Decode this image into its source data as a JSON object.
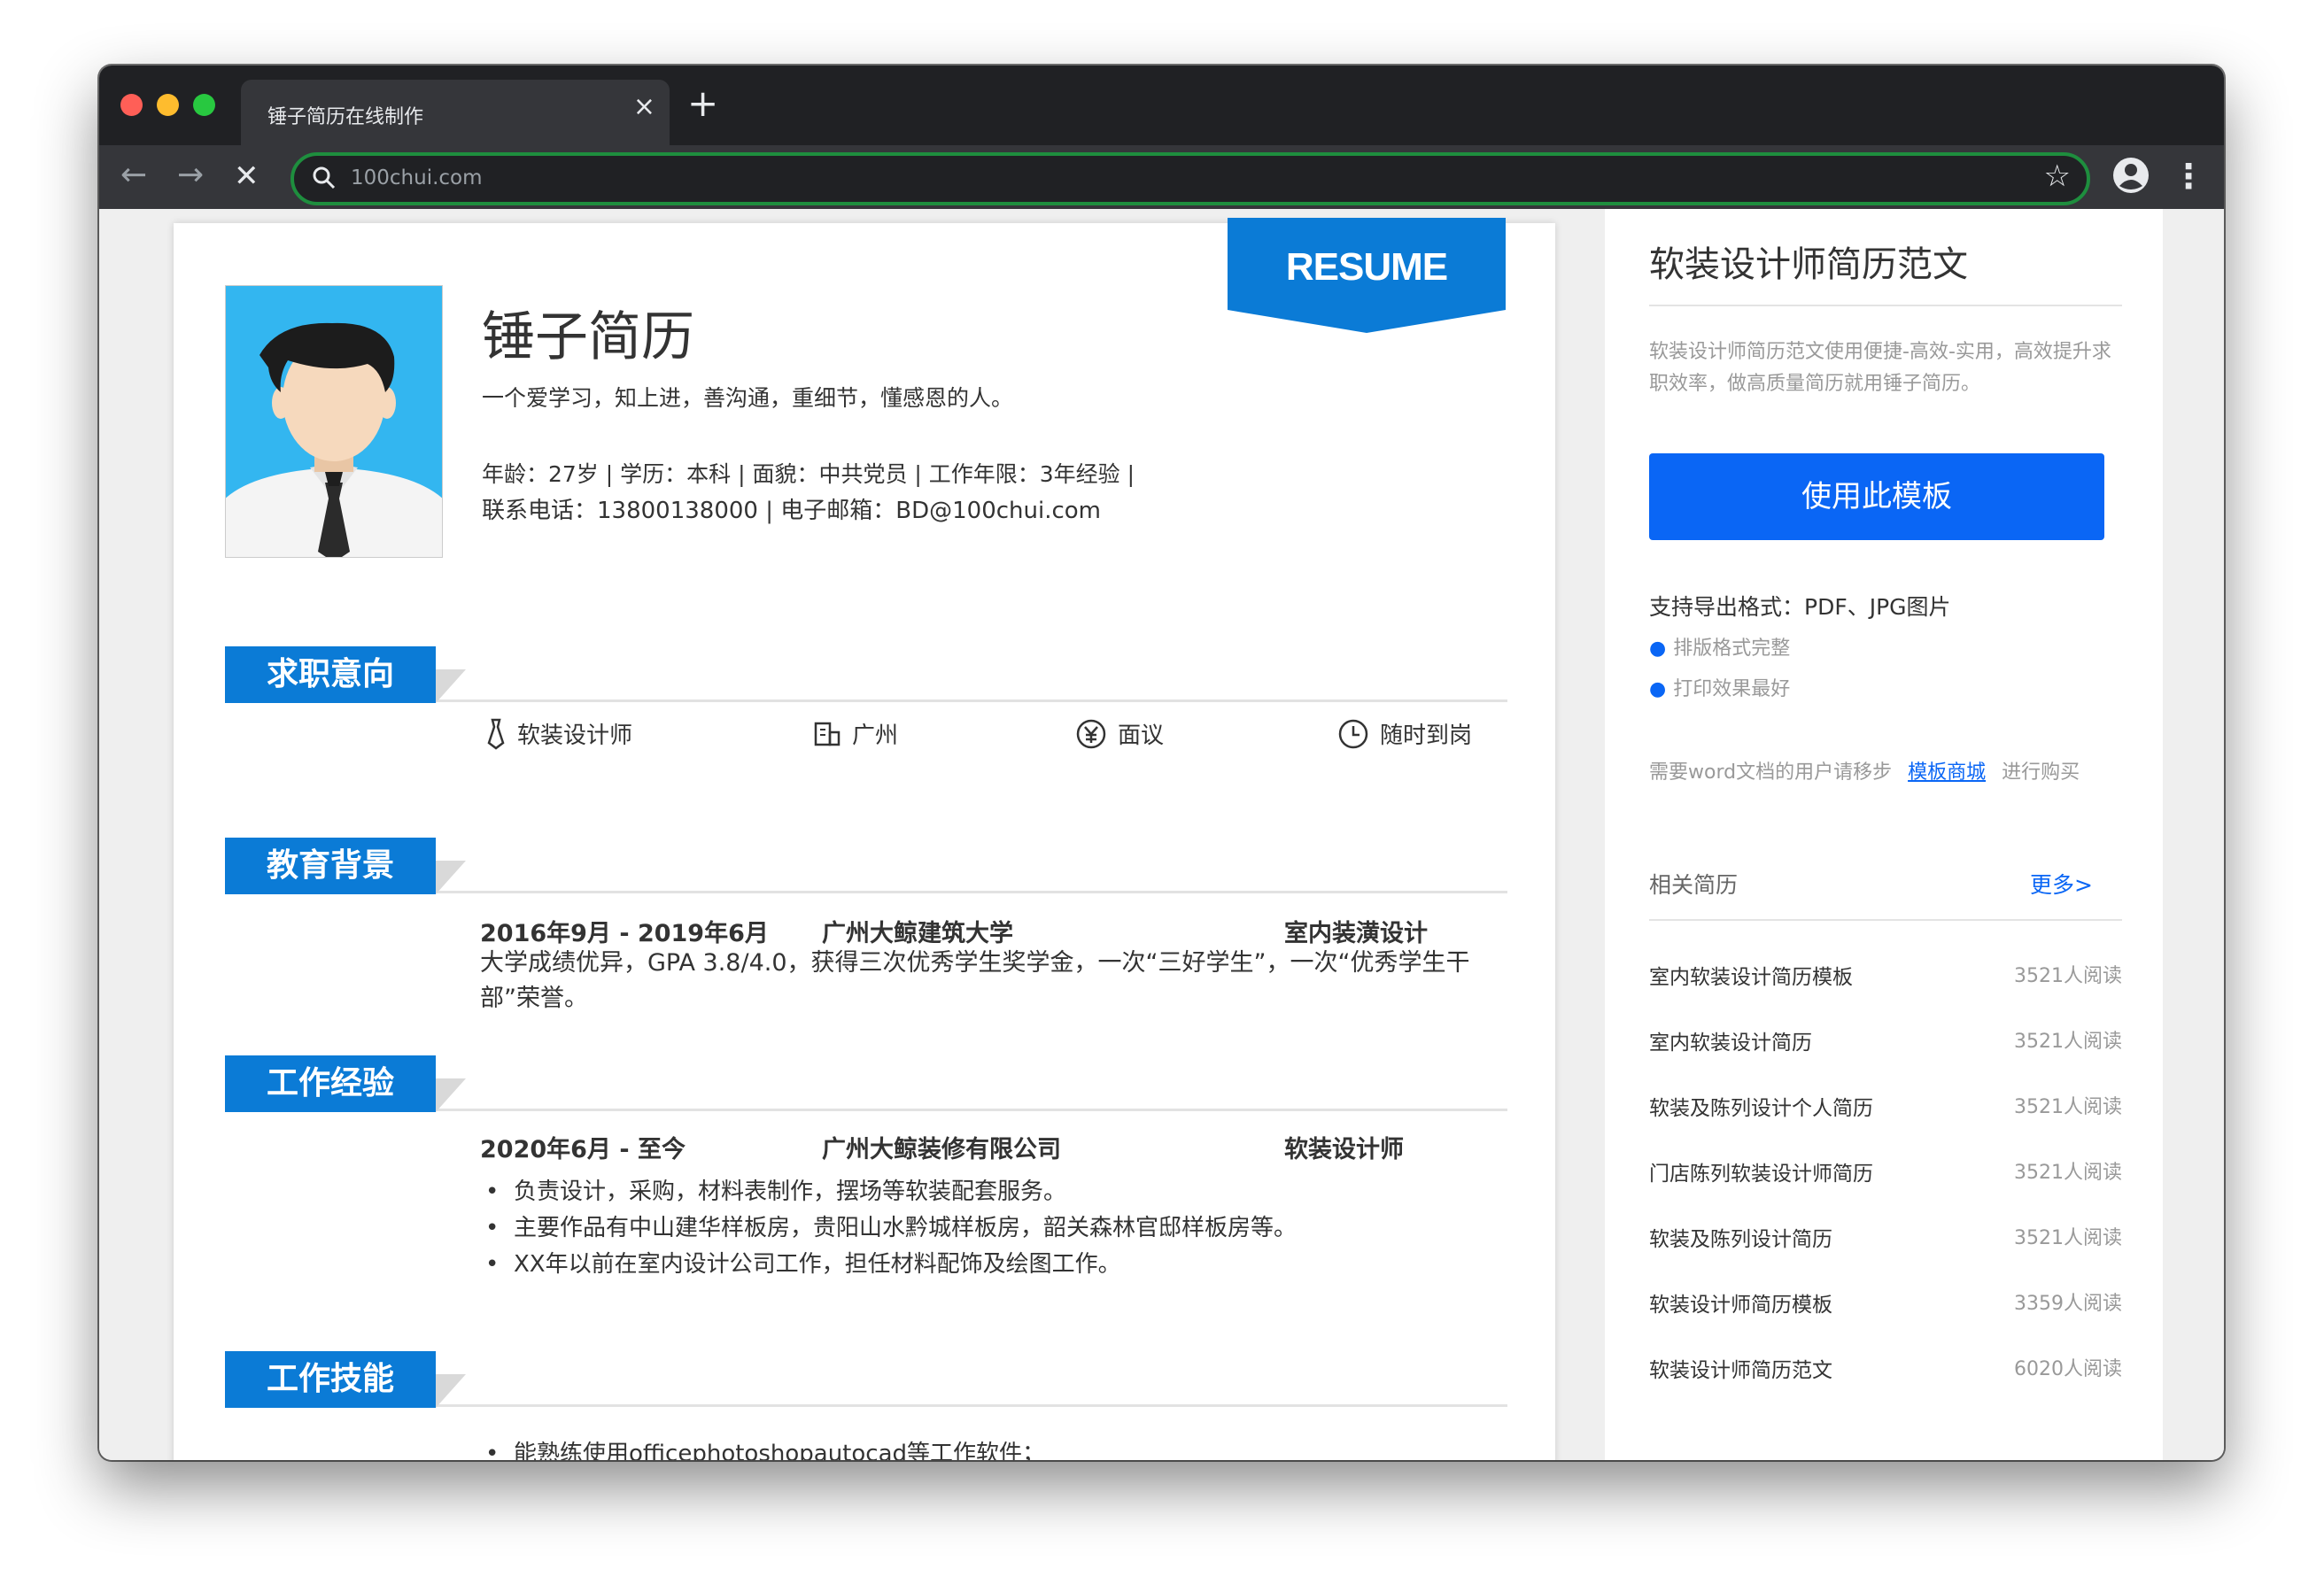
{
  "browser": {
    "tab_title": "锤子简历在线制作",
    "tab_close": "×",
    "new_tab": "+",
    "url": "100chui.com",
    "back": "←",
    "forward": "→",
    "stop": "✕",
    "star": "☆",
    "menu": "⋮"
  },
  "resume": {
    "badge": "RESUME",
    "name": "锤子简历",
    "motto": "一个爱学习，知上进，善沟通，重细节，懂感恩的人。",
    "info_line1": "年龄：27岁 | 学历：本科 | 面貌：中共党员 | 工作年限：3年经验 |",
    "info_line2": "联系电话：13800138000 | 电子邮箱：BD@100chui.com",
    "sections": {
      "intent": "求职意向",
      "education": "教育背景",
      "work": "工作经验",
      "skills": "工作技能"
    },
    "intent": {
      "position": "软装设计师",
      "city": "广州",
      "salary": "面议",
      "availability": "随时到岗"
    },
    "education": {
      "date": "2016年9月 - 2019年6月",
      "school": "广州大鲸建筑大学",
      "major": "室内装潢设计",
      "desc": "大学成绩优异，GPA 3.8/4.0，获得三次优秀学生奖学金，一次“三好学生”，一次“优秀学生干部”荣誉。"
    },
    "work": {
      "date": "2020年6月 - 至今",
      "company": "广州大鲸装修有限公司",
      "role": "软装设计师",
      "bullets": [
        "负责设计，采购，材料表制作，摆场等软装配套服务。",
        "主要作品有中山建华样板房，贵阳山水黔城样板房，韶关森林官邸样板房等。",
        "XX年以前在室内设计公司工作，担任材料配饰及绘图工作。"
      ]
    },
    "skills": {
      "bullets": [
        "能熟练使用officephotoshopautocad等工作软件；"
      ]
    }
  },
  "sidebar": {
    "title": "软装设计师简历范文",
    "desc": "软装设计师简历范文使用便捷-高效-实用，高效提升求职效率，做高质量简历就用锤子简历。",
    "use_button": "使用此模板",
    "export_formats": "支持导出格式：PDF、JPG图片",
    "features": [
      "排版格式完整",
      "打印效果最好"
    ],
    "word_note_prefix": "需要word文档的用户请移步",
    "word_note_link": "模板商城",
    "word_note_suffix": "进行购买",
    "related_title": "相关简历",
    "more_link": "更多>",
    "related": [
      {
        "title": "室内软装设计简历模板",
        "reads": "3521人阅读"
      },
      {
        "title": "室内软装设计简历",
        "reads": "3521人阅读"
      },
      {
        "title": "软装及陈列设计个人简历",
        "reads": "3521人阅读"
      },
      {
        "title": "门店陈列软装设计师简历",
        "reads": "3521人阅读"
      },
      {
        "title": "软装及陈列设计简历",
        "reads": "3521人阅读"
      },
      {
        "title": "软装设计师简历模板",
        "reads": "3359人阅读"
      },
      {
        "title": "软装设计师简历范文",
        "reads": "6020人阅读"
      }
    ]
  }
}
